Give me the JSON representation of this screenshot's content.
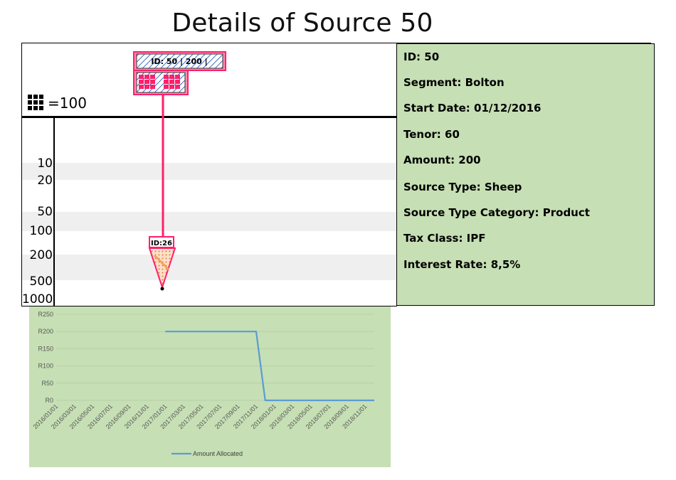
{
  "page": {
    "title": "Details of Source 50"
  },
  "timeline": {
    "legend_text": "=100",
    "source_badge": "ID: 50  |  200  |",
    "target_badge": "ID:26",
    "y_ticks": [
      "10",
      "20",
      "50",
      "100",
      "200",
      "500",
      "1000"
    ]
  },
  "details": {
    "lines": [
      "ID: 50",
      "Segment: Bolton",
      "Start Date: 01/12/2016",
      "Tenor: 60",
      "Amount: 200",
      "Source Type: Sheep",
      "Source Type Category:  Product",
      "Tax Class: IPF",
      "Interest Rate: 8,5%"
    ]
  },
  "colors": {
    "panel_green": "#c6dfb4",
    "accent_pink": "#ff1f6b",
    "series_blue": "#5b9bd5",
    "hatch_blue": "#4472c4",
    "dot_orange": "#f4a261"
  },
  "chart_data": {
    "type": "line",
    "x": [
      "2016/01/01",
      "2016/02/01",
      "2016/03/01",
      "2016/04/01",
      "2016/05/01",
      "2016/06/01",
      "2016/07/01",
      "2016/08/01",
      "2016/09/01",
      "2016/10/01",
      "2016/11/01",
      "2016/12/01",
      "2017/01/01",
      "2017/02/01",
      "2017/03/01",
      "2017/04/01",
      "2017/05/01",
      "2017/06/01",
      "2017/07/01",
      "2017/08/01",
      "2017/09/01",
      "2017/10/01",
      "2017/11/01",
      "2017/12/01",
      "2018/01/01",
      "2018/02/01",
      "2018/03/01",
      "2018/04/01",
      "2018/05/01",
      "2018/06/01",
      "2018/07/01",
      "2018/08/01",
      "2018/09/01",
      "2018/10/01",
      "2018/11/01",
      "2018/12/01"
    ],
    "x_tick_labels": [
      "2016/01/01",
      "2016/03/01",
      "2016/05/01",
      "2016/07/01",
      "2016/09/01",
      "2016/11/01",
      "2017/01/01",
      "2017/03/01",
      "2017/05/01",
      "2017/07/01",
      "2017/09/01",
      "2017/11/01",
      "2018/01/01",
      "2018/03/01",
      "2018/05/01",
      "2018/07/01",
      "2018/09/01",
      "2018/11/01"
    ],
    "series": [
      {
        "name": "Amount Allocated",
        "values": [
          null,
          null,
          null,
          null,
          null,
          null,
          null,
          null,
          null,
          null,
          null,
          null,
          200,
          200,
          200,
          200,
          200,
          200,
          200,
          200,
          200,
          200,
          200,
          0,
          0,
          0,
          0,
          0,
          0,
          0,
          0,
          0,
          0,
          0,
          0,
          0
        ]
      }
    ],
    "y_tick_labels": [
      "R0",
      "R50",
      "R100",
      "R150",
      "R200",
      "R250"
    ],
    "y_ticks": [
      0,
      50,
      100,
      150,
      200,
      250
    ],
    "ylim": [
      0,
      250
    ],
    "grid": true,
    "legend": "bottom"
  }
}
